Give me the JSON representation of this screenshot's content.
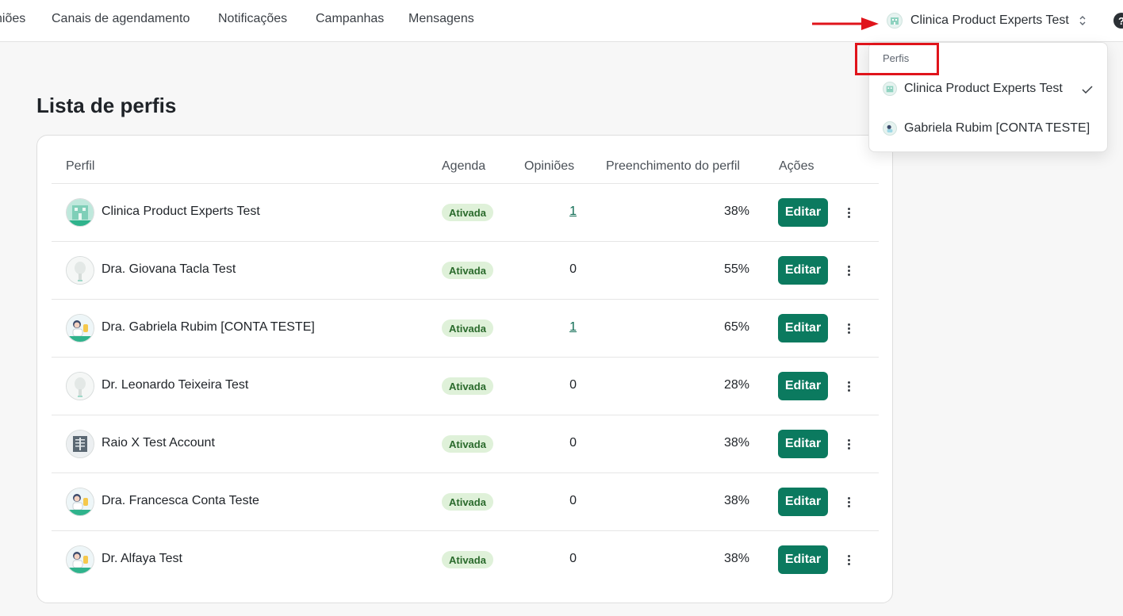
{
  "nav": {
    "items": [
      "niões",
      "Canais de agendamento",
      "Notificações",
      "Campanhas",
      "Mensagens"
    ]
  },
  "account_switcher": {
    "current": "Clinica Product Experts Test",
    "icon": "clinic-avatar-icon"
  },
  "help_icon": "?",
  "dropdown": {
    "header": "Perfis",
    "items": [
      {
        "label": "Clinica Product Experts Test",
        "selected": true
      },
      {
        "label": "Gabriela Rubim [CONTA TESTE]",
        "selected": false
      }
    ]
  },
  "page": {
    "title": "Lista de perfis"
  },
  "table": {
    "headers": {
      "profile": "Perfil",
      "agenda": "Agenda",
      "opinions": "Opiniões",
      "completion": "Preenchimento do perfil",
      "actions": "Ações"
    },
    "edit_label": "Editar",
    "rows": [
      {
        "name": "Clinica Product Experts Test",
        "agenda": "Ativada",
        "opinions": "1",
        "opinions_link": true,
        "completion": "38%",
        "avatar": "clinic-building-icon"
      },
      {
        "name": "Dra. Giovana Tacla Test",
        "agenda": "Ativada",
        "opinions": "0",
        "opinions_link": false,
        "completion": "55%",
        "avatar": "placeholder-avatar-icon"
      },
      {
        "name": "Dra. Gabriela Rubim [CONTA TESTE]",
        "agenda": "Ativada",
        "opinions": "1",
        "opinions_link": true,
        "completion": "65%",
        "avatar": "doctor-avatar-icon"
      },
      {
        "name": "Dr. Leonardo Teixeira Test",
        "agenda": "Ativada",
        "opinions": "0",
        "opinions_link": false,
        "completion": "28%",
        "avatar": "placeholder-avatar-icon"
      },
      {
        "name": "Raio X Test Account",
        "agenda": "Ativada",
        "opinions": "0",
        "opinions_link": false,
        "completion": "38%",
        "avatar": "xray-icon"
      },
      {
        "name": "Dra. Francesca Conta Teste",
        "agenda": "Ativada",
        "opinions": "0",
        "opinions_link": false,
        "completion": "38%",
        "avatar": "doctor-avatar-icon"
      },
      {
        "name": "Dr. Alfaya Test",
        "agenda": "Ativada",
        "opinions": "0",
        "opinions_link": false,
        "completion": "38%",
        "avatar": "doctor-avatar-icon"
      }
    ]
  },
  "colors": {
    "accent": "#0b7a5f",
    "badge_bg": "#dff1d9",
    "badge_text": "#2a6a2c",
    "annotation_red": "#e0141b"
  }
}
